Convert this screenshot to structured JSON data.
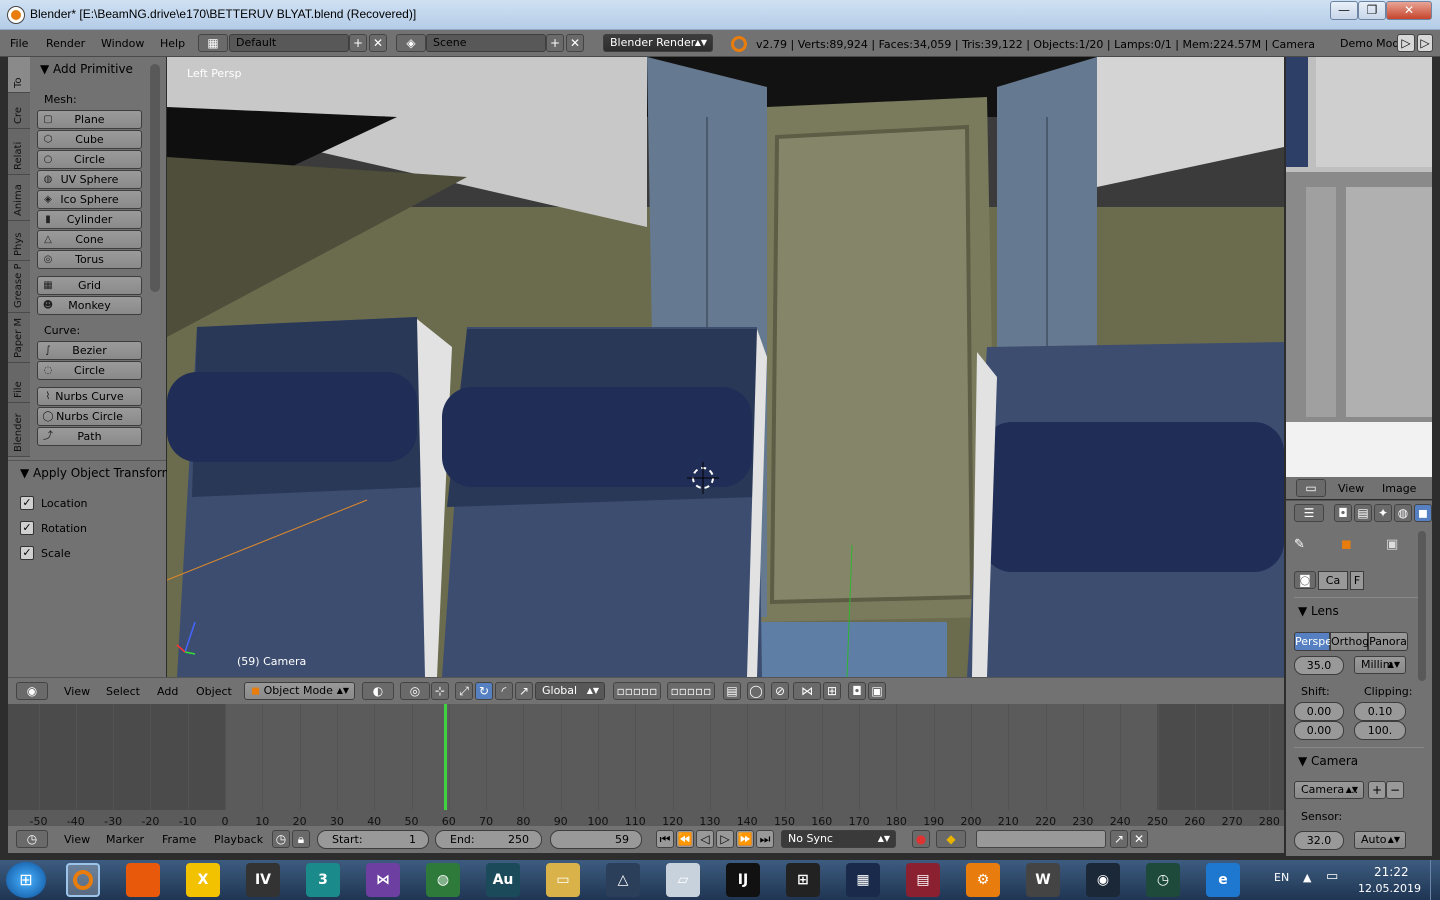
{
  "window": {
    "title": "Blender* [E:\\BeamNG.drive\\e170\\BETTERUV BLYAT.blend (Recovered)]",
    "min_label": "—",
    "max_label": "❐",
    "close_label": "✕"
  },
  "header": {
    "menus": [
      "File",
      "Render",
      "Window",
      "Help"
    ],
    "layout_name": "Default",
    "scene_name": "Scene",
    "render_engine": "Blender Render",
    "stats": "v2.79 | Verts:89,924 | Faces:34,059 | Tris:39,122 | Objects:1/20 | Lamps:0/1 | Mem:224.57M | Camera",
    "demo_mode": "Demo Mode:"
  },
  "toolshelf": {
    "tabs": [
      "To",
      "Cre",
      "Relati",
      "Anima",
      "Phys",
      "Grease P",
      "Paper M",
      "File",
      "Blender"
    ],
    "panel_title": "Add Primitive",
    "mesh_label": "Mesh:",
    "mesh_items": [
      {
        "label": "Plane",
        "icon": "plane-icon"
      },
      {
        "label": "Cube",
        "icon": "cube-icon"
      },
      {
        "label": "Circle",
        "icon": "circle-icon"
      },
      {
        "label": "UV Sphere",
        "icon": "uv-sphere-icon"
      },
      {
        "label": "Ico Sphere",
        "icon": "ico-sphere-icon"
      },
      {
        "label": "Cylinder",
        "icon": "cylinder-icon"
      },
      {
        "label": "Cone",
        "icon": "cone-icon"
      },
      {
        "label": "Torus",
        "icon": "torus-icon"
      },
      {
        "label": "Grid",
        "icon": "grid-icon"
      },
      {
        "label": "Monkey",
        "icon": "monkey-icon"
      }
    ],
    "curve_label": "Curve:",
    "curve_items": [
      {
        "label": "Bezier",
        "icon": "bezier-icon"
      },
      {
        "label": "Circle",
        "icon": "curve-circle-icon"
      },
      {
        "label": "Nurbs Curve",
        "icon": "nurbs-curve-icon"
      },
      {
        "label": "Nurbs Circle",
        "icon": "nurbs-circle-icon"
      },
      {
        "label": "Path",
        "icon": "path-icon"
      }
    ],
    "operator_title": "Apply Object Transform",
    "operator_options": [
      {
        "label": "Location",
        "checked": true
      },
      {
        "label": "Rotation",
        "checked": true
      },
      {
        "label": "Scale",
        "checked": true
      }
    ]
  },
  "viewport": {
    "view_name": "Left Persp",
    "object_label": "(59) Camera"
  },
  "view3d_header": {
    "menus": [
      "View",
      "Select",
      "Add",
      "Object"
    ],
    "mode": "Object Mode",
    "orientation": "Global"
  },
  "image_editor": {
    "menus": [
      "View",
      "Image"
    ]
  },
  "properties": {
    "tabs": [
      "Ca",
      "F"
    ],
    "lens_title": "Lens",
    "projection": [
      "Perspe",
      "Orthog",
      "Panora"
    ],
    "focal_length": "35.0",
    "lens_unit": "Millim",
    "shift_label": "Shift:",
    "shift_x": "0.00",
    "shift_y": "0.00",
    "clipping_label": "Clipping:",
    "clip_start": "0.10",
    "clip_end": "100.",
    "camera_title": "Camera",
    "camera_preset": "Camera ...",
    "sensor_label": "Sensor:",
    "sensor_size": "32.0",
    "sensor_fit": "Auto"
  },
  "timeline": {
    "ticks": [
      "-50",
      "-40",
      "-30",
      "-20",
      "-10",
      "0",
      "10",
      "20",
      "30",
      "40",
      "50",
      "60",
      "70",
      "80",
      "90",
      "100",
      "110",
      "120",
      "130",
      "140",
      "150",
      "160",
      "170",
      "180",
      "190",
      "200",
      "210",
      "220",
      "230",
      "240",
      "250",
      "260",
      "270",
      "280"
    ],
    "current_frame_value": 59,
    "menus": [
      "View",
      "Marker",
      "Frame",
      "Playback"
    ],
    "start_label": "Start:",
    "start": "1",
    "end_label": "End:",
    "end": "250",
    "current_frame": "59",
    "sync": "No Sync"
  },
  "taskbar": {
    "language": "EN",
    "time": "21:22",
    "date": "12.05.2019",
    "apps": [
      {
        "name": "blender-icon",
        "label": "",
        "color": "#e87d0d"
      },
      {
        "name": "nodes-app-icon",
        "label": "",
        "color": "#e8590c"
      },
      {
        "name": "x-app-icon",
        "label": "X",
        "color": "#f2c200"
      },
      {
        "name": "gta-iv-icon",
        "label": "IV",
        "color": "#333333"
      },
      {
        "name": "3dsmax-icon",
        "label": "3",
        "color": "#1a8a8a"
      },
      {
        "name": "visual-studio-icon",
        "label": "⋈",
        "color": "#6c3fa0"
      },
      {
        "name": "globe-app-icon",
        "label": "◍",
        "color": "#2d7a3a"
      },
      {
        "name": "audition-icon",
        "label": "Au",
        "color": "#1b4a5a"
      },
      {
        "name": "explorer-icon",
        "label": "▭",
        "color": "#d9b24a"
      },
      {
        "name": "triangle-app-icon",
        "label": "△",
        "color": "#2b3f5a"
      },
      {
        "name": "paper-app-icon",
        "label": "▱",
        "color": "#c8d2dc"
      },
      {
        "name": "intellij-icon",
        "label": "IJ",
        "color": "#111111"
      },
      {
        "name": "piano-app-icon",
        "label": "⊞",
        "color": "#222222"
      },
      {
        "name": "daw-app-icon",
        "label": "▦",
        "color": "#1a2a4a"
      },
      {
        "name": "winrar-icon",
        "label": "▤",
        "color": "#8a2030"
      },
      {
        "name": "gear-app-icon",
        "label": "⚙",
        "color": "#e87d0d"
      },
      {
        "name": "w-app-icon",
        "label": "W",
        "color": "#444444"
      },
      {
        "name": "steam-icon",
        "label": "◉",
        "color": "#1b2838"
      },
      {
        "name": "monitor-app-icon",
        "label": "◷",
        "color": "#1d4a3a"
      },
      {
        "name": "ie-icon",
        "label": "e",
        "color": "#1e78d0"
      }
    ]
  },
  "colors": {
    "panel": "#727272",
    "accent_blue": "#5680c2",
    "frame_line": "#3fd33f",
    "blender_orange": "#e87d0d"
  }
}
